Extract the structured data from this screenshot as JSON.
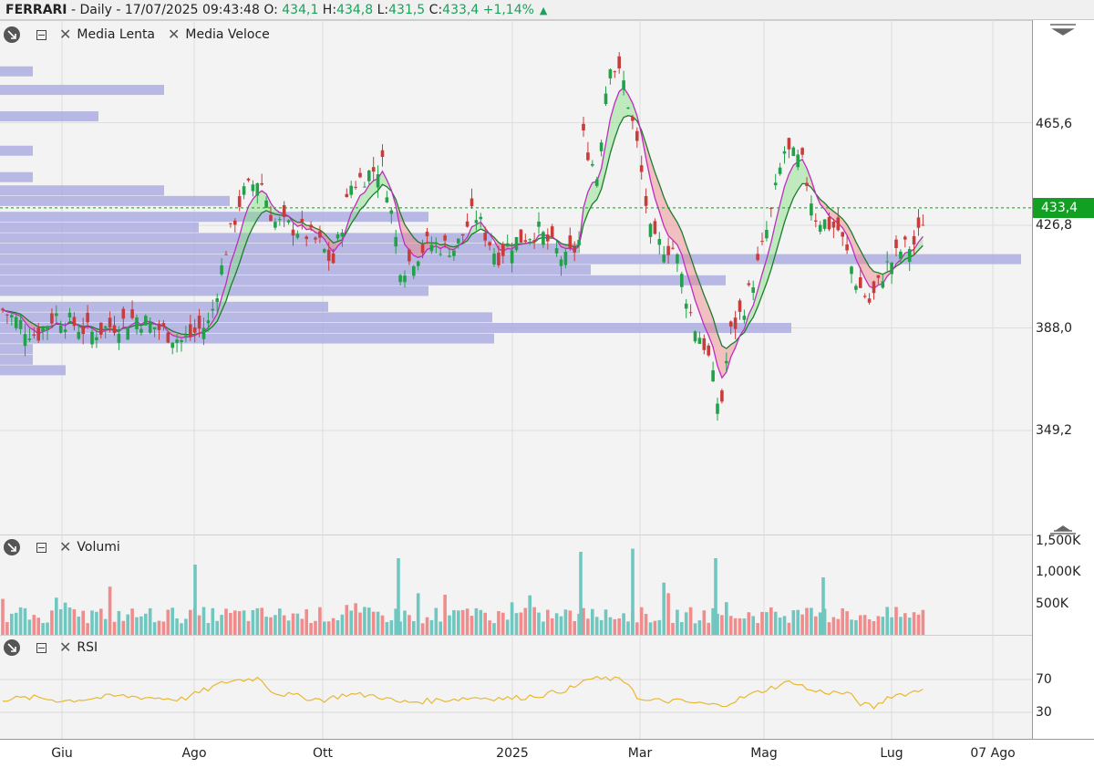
{
  "header": {
    "symbol": "FERRARI",
    "info": " - Daily - 17/07/2025 09:43:48",
    "o_label": " O: ",
    "o_val": "434,1",
    "h_label": " H:",
    "h_val": "434,8",
    "l_label": " L:",
    "l_val": "431,5",
    "c_label": " C:",
    "c_val": "433,4",
    "change": " +1,14%"
  },
  "legends": {
    "main": [
      "Media Lenta",
      "Media Veloce"
    ],
    "volume": "Volumi",
    "rsi": "RSI"
  },
  "price_axis": {
    "ticks": [
      "465,6",
      "426,8",
      "388,0",
      "349,2"
    ],
    "last_price": "433,4"
  },
  "volume_axis": {
    "ticks": [
      "1,500K",
      "1,000K",
      "500K"
    ]
  },
  "rsi_axis": {
    "ticks": [
      "70",
      "30"
    ]
  },
  "x_axis": {
    "labels": [
      "Giu",
      "Ago",
      "Ott",
      "2025",
      "Mar",
      "Mag",
      "Lug",
      "07 Ago"
    ]
  },
  "colors": {
    "up": "#22a04a",
    "down": "#c83c3c",
    "vol_up": "#6fc7c0",
    "vol_down": "#f08c8c",
    "slow_ma": "#1f7a2e",
    "fast_ma": "#c02cc0",
    "rsi": "#e8b830",
    "profile": "#a9a9e0",
    "last_price": "#12a022"
  },
  "chart_data": [
    {
      "type": "candlestick",
      "title": "FERRARI - Daily",
      "x_range": [
        "2025-05-16",
        "2025-08-14"
      ],
      "y_range": [
        310,
        503
      ],
      "series": [
        {
          "name": "Media Lenta",
          "type": "line"
        },
        {
          "name": "Media Veloce",
          "type": "line"
        }
      ],
      "close_path_points": [
        [
          "Giu-start",
          395
        ],
        [
          "Giu",
          392
        ],
        [
          "Giu-end",
          394
        ],
        [
          "Ago",
          393
        ],
        [
          "Ago-mid",
          430
        ],
        [
          "Ago-peak",
          440
        ],
        [
          "Set",
          425
        ],
        [
          "Ott",
          418
        ],
        [
          "Ott-mid",
          440
        ],
        [
          "Nov",
          418
        ],
        [
          "Nov-mid",
          428
        ],
        [
          "Dic",
          420
        ],
        [
          "2025",
          418
        ],
        [
          "Feb",
          440
        ],
        [
          "Feb-peak",
          478
        ],
        [
          "Mar",
          450
        ],
        [
          "Mar-mid",
          412
        ],
        [
          "Apr-low",
          360
        ],
        [
          "Apr-end",
          395
        ],
        [
          "Mag",
          410
        ],
        [
          "Mag-peak",
          452
        ],
        [
          "Giu2",
          430
        ],
        [
          "Giu2-low",
          402
        ],
        [
          "Lug",
          420
        ],
        [
          "Lug-last",
          433.4
        ]
      ],
      "last_close": 433.4,
      "volume_profile": true
    },
    {
      "type": "bar",
      "title": "Volumi",
      "y_range": [
        0,
        1600000
      ],
      "notable_peaks": [
        {
          "x": "Ago-start",
          "value": 1100000
        },
        {
          "x": "Ott-end",
          "value": 1200000
        },
        {
          "x": "Feb-mid",
          "value": 1300000
        },
        {
          "x": "Mar-start",
          "value": 1350000
        },
        {
          "x": "Apr-mid",
          "value": 1200000
        }
      ]
    },
    {
      "type": "line",
      "title": "RSI",
      "levels": [
        70,
        30
      ],
      "y_range": [
        10,
        90
      ],
      "key_points": [
        [
          "Giu",
          46
        ],
        [
          "Ago-peak",
          72
        ],
        [
          "Ott",
          45
        ],
        [
          "Ott-end",
          44
        ],
        [
          "Nov",
          42
        ],
        [
          "Dic",
          50
        ],
        [
          "2025",
          48
        ],
        [
          "Feb-peak",
          71
        ],
        [
          "Mar",
          43
        ],
        [
          "Apr-low",
          38
        ],
        [
          "Mag-peak",
          68
        ],
        [
          "Giu2-low",
          36
        ],
        [
          "Lug-last",
          60
        ]
      ]
    }
  ]
}
